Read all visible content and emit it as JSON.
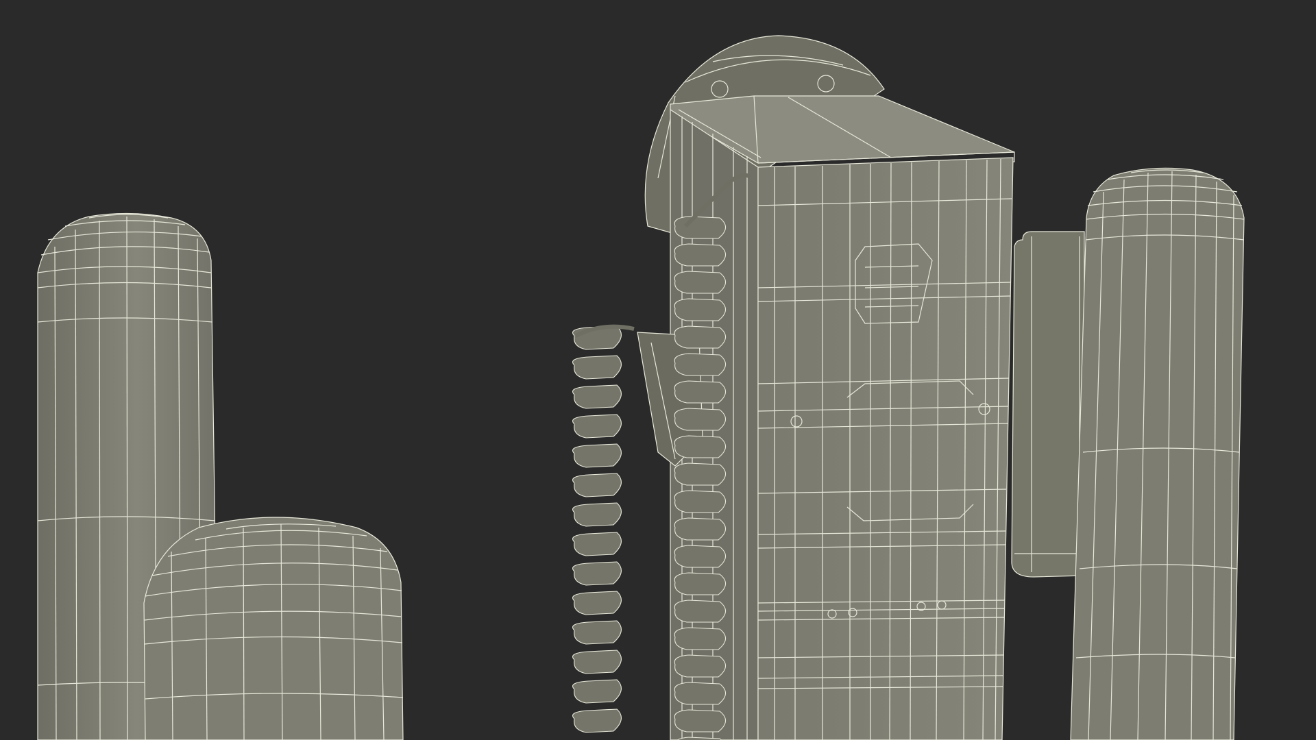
{
  "scene": {
    "background_color": "#2a2a2a",
    "mesh_fill_color": "#7d7d72",
    "wire_color": "#e8e8da",
    "objects": [
      "bollard-left-tall",
      "bollard-left-short",
      "charging-station-unit",
      "coiled-charging-cable",
      "bollard-right",
      "wall-plate-right"
    ]
  }
}
